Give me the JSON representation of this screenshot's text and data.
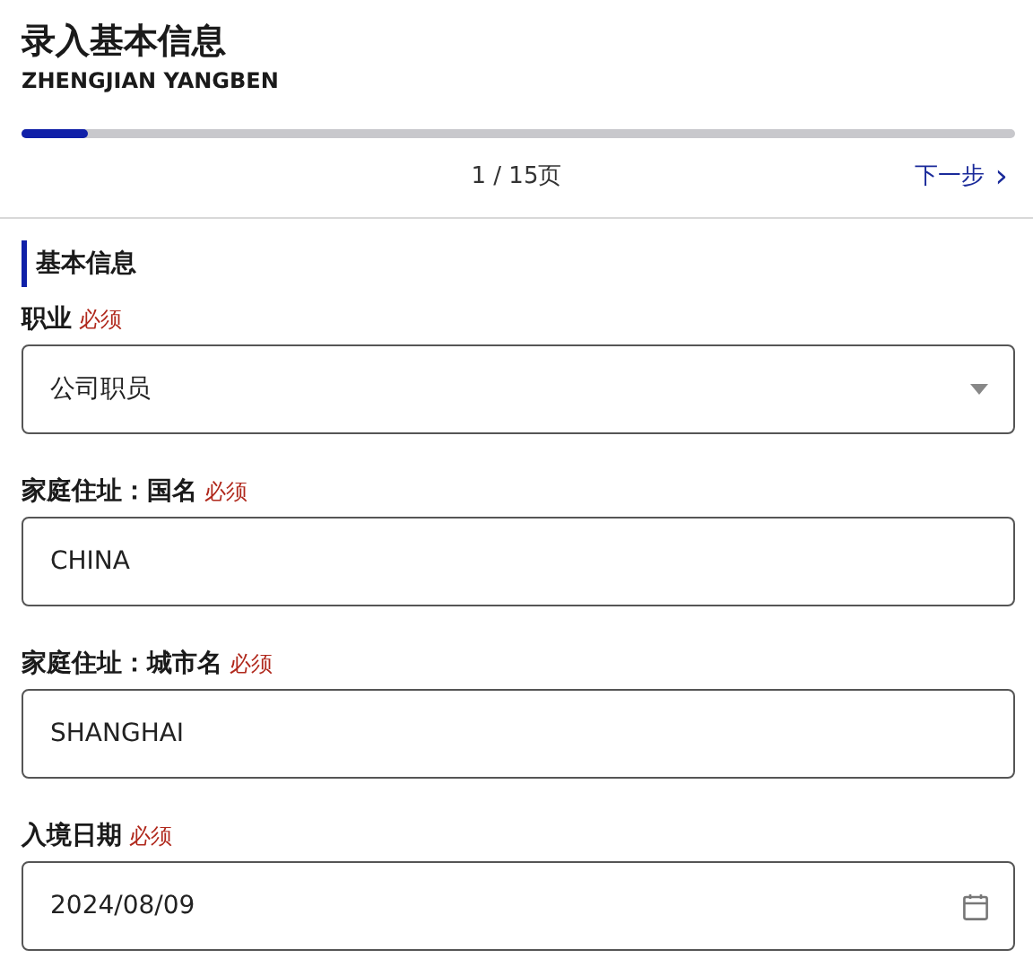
{
  "header": {
    "title": "录入基本信息",
    "subtitle": "ZHENGJIAN YANGBEN"
  },
  "progress": {
    "level": 0.067
  },
  "pager": {
    "page": "1 / 15页",
    "next": "下一步",
    "next_icon": "›"
  },
  "section": {
    "title": "基本信息"
  },
  "fields": [
    {
      "kind": "select",
      "label": "职业",
      "required": "必须",
      "value": "公司职员"
    },
    {
      "kind": "text",
      "label": "家庭住址：国名",
      "required": "必须",
      "value": "CHINA"
    },
    {
      "kind": "text",
      "label": "家庭住址：城市名",
      "required": "必须",
      "value": "SHANGHAI"
    },
    {
      "kind": "date",
      "label": "入境日期",
      "required": "必须",
      "value": "2024/08/09"
    }
  ]
}
